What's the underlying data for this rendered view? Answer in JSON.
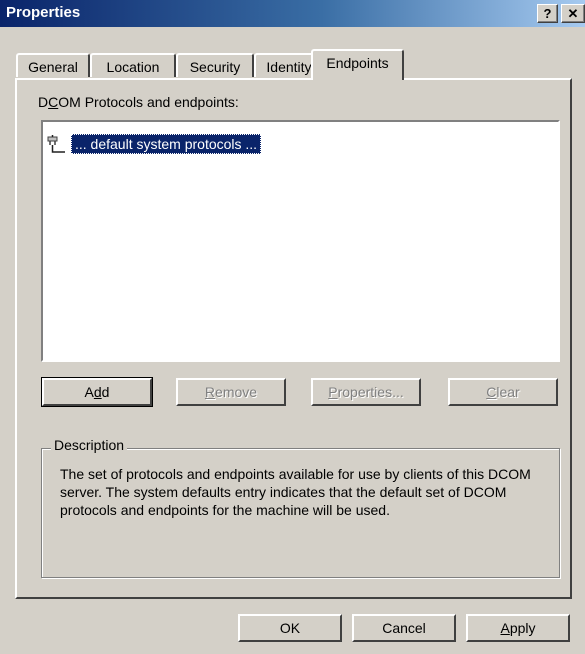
{
  "window": {
    "title": "Properties",
    "help_label": "?",
    "close_label": "✕"
  },
  "tabs": [
    {
      "label": "General",
      "active": false
    },
    {
      "label": "Location",
      "active": false
    },
    {
      "label": "Security",
      "active": false
    },
    {
      "label": "Identity",
      "active": false
    },
    {
      "label": "Endpoints",
      "active": true
    }
  ],
  "endpoints": {
    "list_label_prefix": "D",
    "list_label_mnemonic": "C",
    "list_label_suffix": "OM Protocols and endpoints:",
    "items": [
      {
        "text": "... default system protocols ...",
        "selected": true,
        "icon": "network-plug-icon"
      }
    ],
    "buttons": {
      "add": {
        "pre": "A",
        "mn": "d",
        "post": "d"
      },
      "remove": {
        "pre": "",
        "mn": "R",
        "post": "emove"
      },
      "properties": {
        "pre": "",
        "mn": "P",
        "post": "roperties..."
      },
      "clear": {
        "pre": "",
        "mn": "C",
        "post": "lear"
      }
    },
    "description": {
      "label": "Description",
      "text": "The set of protocols and endpoints available for use by clients of this DCOM server. The system defaults entry indicates that the default set of DCOM protocols and endpoints for the machine will be used."
    }
  },
  "footer": {
    "ok_label": "OK",
    "cancel_label": "Cancel",
    "apply": {
      "pre": "",
      "mn": "A",
      "post": "pply"
    }
  }
}
